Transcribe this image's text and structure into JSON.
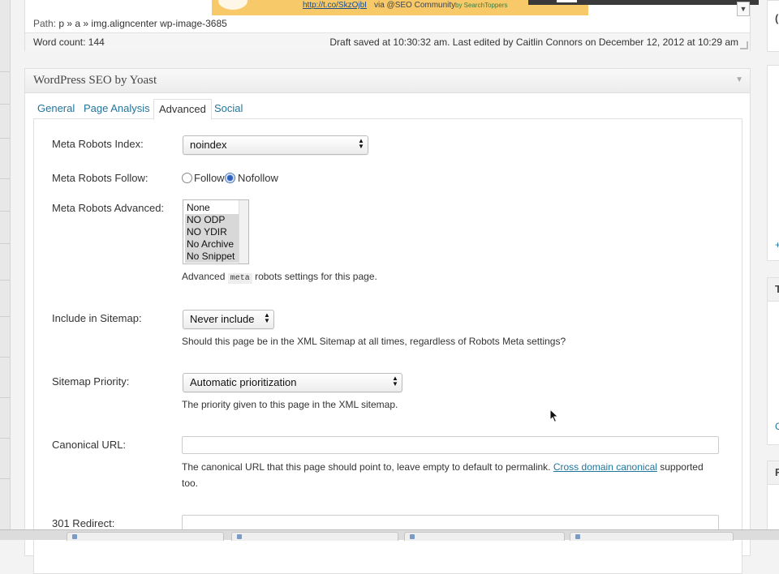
{
  "editor": {
    "preview_link": "http://t.co/SkzOjbI",
    "preview_via": "via @SEO Community",
    "preview_by": "by SearchToppers",
    "path_label": "Path:",
    "path_value": "p » a » img.aligncenter wp-image-3685",
    "word_count": "Word count: 144",
    "draft_status": "Draft saved at 10:30:32 am. Last edited by Caitlin Connors on December 12, 2012 at 10:29 am"
  },
  "seo": {
    "box_title": "WordPress SEO by Yoast",
    "tabs": [
      {
        "label": "General",
        "active": false
      },
      {
        "label": "Page Analysis",
        "active": false
      },
      {
        "label": "Advanced",
        "active": true
      },
      {
        "label": "Social",
        "active": false
      }
    ],
    "fields": {
      "robots_index": {
        "label": "Meta Robots Index:",
        "value": "noindex"
      },
      "robots_follow": {
        "label": "Meta Robots Follow:",
        "options": [
          "Follow",
          "Nofollow"
        ],
        "selected": "Nofollow"
      },
      "robots_advanced": {
        "label": "Meta Robots Advanced:",
        "options": [
          {
            "label": "None",
            "selected": false
          },
          {
            "label": "NO ODP",
            "selected": true
          },
          {
            "label": "NO YDIR",
            "selected": true
          },
          {
            "label": "No Archive",
            "selected": true
          },
          {
            "label": "No Snippet",
            "selected": true
          }
        ],
        "help_prefix": "Advanced",
        "help_code": "meta",
        "help_suffix": "robots settings for this page."
      },
      "sitemap_include": {
        "label": "Include in Sitemap:",
        "value": "Never include",
        "help": "Should this page be in the XML Sitemap at all times, regardless of Robots Meta settings?"
      },
      "sitemap_priority": {
        "label": "Sitemap Priority:",
        "value": "Automatic prioritization",
        "help": "The priority given to this page in the XML sitemap."
      },
      "canonical": {
        "label": "Canonical URL:",
        "value": "",
        "help_text": "The canonical URL that this page should point to, leave empty to default to permalink.",
        "help_link": "Cross domain canonical",
        "help_after": "supported",
        "help_line2": "too."
      },
      "redirect": {
        "label": "301 Redirect:",
        "value": ""
      }
    }
  },
  "icons": {
    "toggle": "triangle-down-icon",
    "select_arrows": "updown-arrows-icon",
    "cursor": "mouse-pointer-icon"
  },
  "colors": {
    "link": "#21759b",
    "accent_preview": "#f7c968"
  }
}
